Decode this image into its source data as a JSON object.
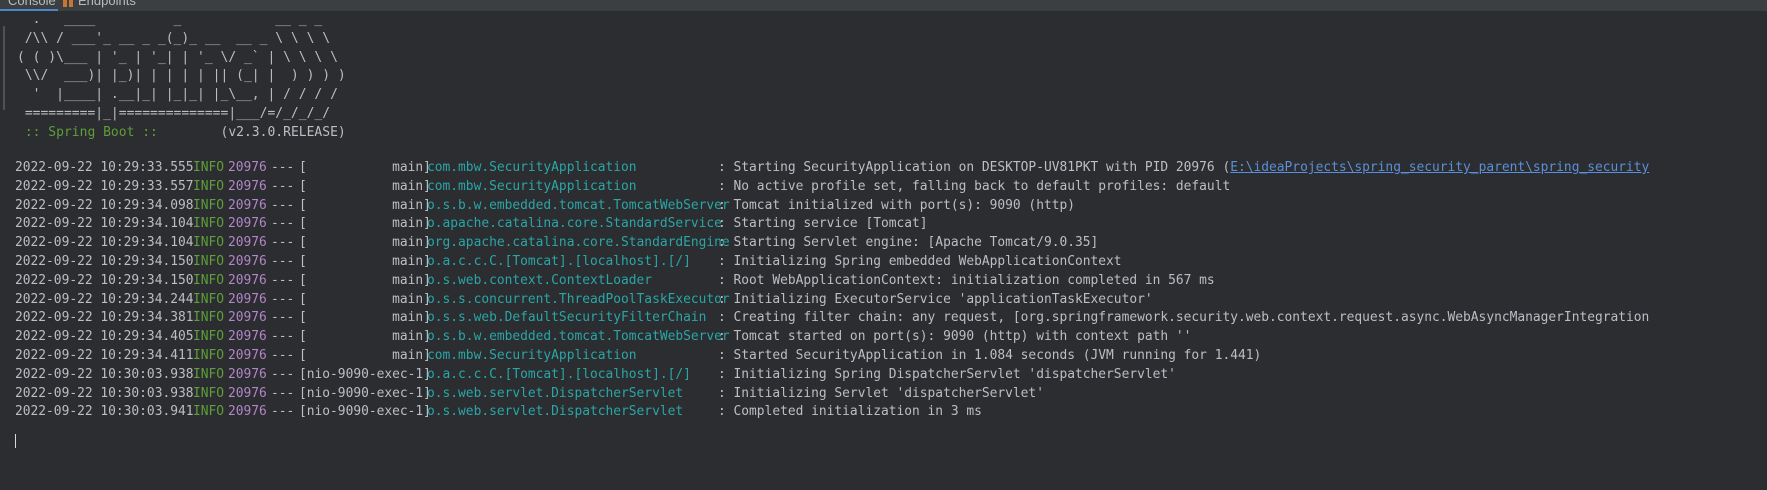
{
  "tabs": {
    "console": "Console",
    "endpoints": "Endpoints"
  },
  "banner": {
    "lines": [
      "  .   ____          _            __ _ _",
      " /\\\\ / ___'_ __ _ _(_)_ __  __ _ \\ \\ \\ \\",
      "( ( )\\___ | '_ | '_| | '_ \\/ _` | \\ \\ \\ \\",
      " \\\\/  ___)| |_)| | | | | || (_| |  ) ) ) )",
      "  '  |____| .__|_| |_|_| |_\\__, | / / / /",
      " =========|_|==============|___/=/_/_/_/"
    ],
    "boot_label": " :: Spring Boot :: ",
    "boot_version": "       (v2.3.0.RELEASE)"
  },
  "log": [
    {
      "ts": "2022-09-22 10:29:33.555",
      "level": "INFO",
      "pid": "20976",
      "sep": "---",
      "thread": "[           main]",
      "logger": "com.mbw.SecurityApplication",
      "msg": ": Starting SecurityApplication on DESKTOP-UV81PKT with PID 20976 (",
      "link": "E:\\ideaProjects\\spring_security_parent\\spring_security"
    },
    {
      "ts": "2022-09-22 10:29:33.557",
      "level": "INFO",
      "pid": "20976",
      "sep": "---",
      "thread": "[           main]",
      "logger": "com.mbw.SecurityApplication",
      "msg": ": No active profile set, falling back to default profiles: default",
      "link": ""
    },
    {
      "ts": "2022-09-22 10:29:34.098",
      "level": "INFO",
      "pid": "20976",
      "sep": "---",
      "thread": "[           main]",
      "logger": "o.s.b.w.embedded.tomcat.TomcatWebServer",
      "msg": ": Tomcat initialized with port(s): 9090 (http)",
      "link": ""
    },
    {
      "ts": "2022-09-22 10:29:34.104",
      "level": "INFO",
      "pid": "20976",
      "sep": "---",
      "thread": "[           main]",
      "logger": "o.apache.catalina.core.StandardService",
      "msg": ": Starting service [Tomcat]",
      "link": ""
    },
    {
      "ts": "2022-09-22 10:29:34.104",
      "level": "INFO",
      "pid": "20976",
      "sep": "---",
      "thread": "[           main]",
      "logger": "org.apache.catalina.core.StandardEngine",
      "msg": ": Starting Servlet engine: [Apache Tomcat/9.0.35]",
      "link": ""
    },
    {
      "ts": "2022-09-22 10:29:34.150",
      "level": "INFO",
      "pid": "20976",
      "sep": "---",
      "thread": "[           main]",
      "logger": "o.a.c.c.C.[Tomcat].[localhost].[/]",
      "msg": ": Initializing Spring embedded WebApplicationContext",
      "link": ""
    },
    {
      "ts": "2022-09-22 10:29:34.150",
      "level": "INFO",
      "pid": "20976",
      "sep": "---",
      "thread": "[           main]",
      "logger": "o.s.web.context.ContextLoader",
      "msg": ": Root WebApplicationContext: initialization completed in 567 ms",
      "link": ""
    },
    {
      "ts": "2022-09-22 10:29:34.244",
      "level": "INFO",
      "pid": "20976",
      "sep": "---",
      "thread": "[           main]",
      "logger": "o.s.s.concurrent.ThreadPoolTaskExecutor",
      "msg": ": Initializing ExecutorService 'applicationTaskExecutor'",
      "link": ""
    },
    {
      "ts": "2022-09-22 10:29:34.381",
      "level": "INFO",
      "pid": "20976",
      "sep": "---",
      "thread": "[           main]",
      "logger": "o.s.s.web.DefaultSecurityFilterChain",
      "msg": ": Creating filter chain: any request, [org.springframework.security.web.context.request.async.WebAsyncManagerIntegration",
      "link": ""
    },
    {
      "ts": "2022-09-22 10:29:34.405",
      "level": "INFO",
      "pid": "20976",
      "sep": "---",
      "thread": "[           main]",
      "logger": "o.s.b.w.embedded.tomcat.TomcatWebServer",
      "msg": ": Tomcat started on port(s): 9090 (http) with context path ''",
      "link": ""
    },
    {
      "ts": "2022-09-22 10:29:34.411",
      "level": "INFO",
      "pid": "20976",
      "sep": "---",
      "thread": "[           main]",
      "logger": "com.mbw.SecurityApplication",
      "msg": ": Started SecurityApplication in 1.084 seconds (JVM running for 1.441)",
      "link": ""
    },
    {
      "ts": "2022-09-22 10:30:03.938",
      "level": "INFO",
      "pid": "20976",
      "sep": "---",
      "thread": "[nio-9090-exec-1]",
      "logger": "o.a.c.c.C.[Tomcat].[localhost].[/]",
      "msg": ": Initializing Spring DispatcherServlet 'dispatcherServlet'",
      "link": ""
    },
    {
      "ts": "2022-09-22 10:30:03.938",
      "level": "INFO",
      "pid": "20976",
      "sep": "---",
      "thread": "[nio-9090-exec-1]",
      "logger": "o.s.web.servlet.DispatcherServlet",
      "msg": ": Initializing Servlet 'dispatcherServlet'",
      "link": ""
    },
    {
      "ts": "2022-09-22 10:30:03.941",
      "level": "INFO",
      "pid": "20976",
      "sep": "---",
      "thread": "[nio-9090-exec-1]",
      "logger": "o.s.web.servlet.DispatcherServlet",
      "msg": ": Completed initialization in 3 ms",
      "link": ""
    }
  ],
  "colors": {
    "background": "#2b2d30",
    "text": "#bcbec4",
    "level_info": "#5f9e3a",
    "pid": "#b385c9",
    "logger": "#2aa6a6",
    "link": "#5b8fd8"
  },
  "icons": {
    "console_tab": "console-icon",
    "endpoints_tab": "endpoints-icon"
  }
}
